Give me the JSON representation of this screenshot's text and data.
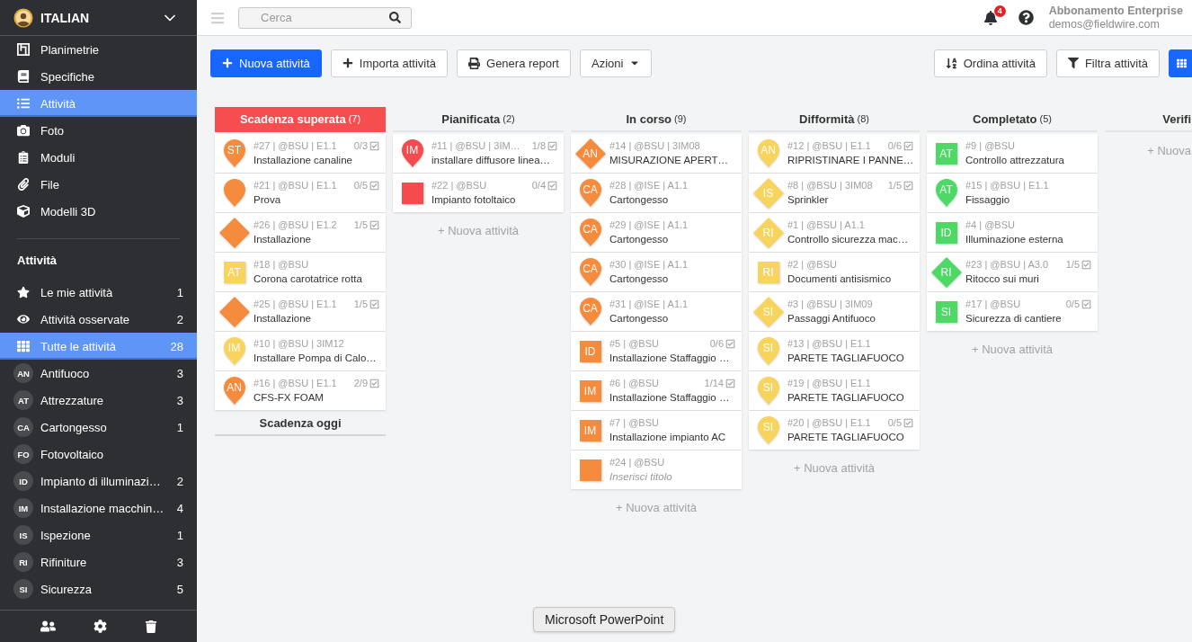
{
  "sidebar": {
    "project": {
      "name": "ITALIAN"
    },
    "nav": [
      {
        "label": "Planimetrie",
        "selected": false
      },
      {
        "label": "Specifiche",
        "selected": false
      },
      {
        "label": "Attività",
        "selected": true
      },
      {
        "label": "Foto",
        "selected": false
      },
      {
        "label": "Moduli",
        "selected": false
      },
      {
        "label": "File",
        "selected": false
      },
      {
        "label": "Modelli 3D",
        "selected": false
      }
    ],
    "section_title": "Attività",
    "filters": [
      {
        "kind": "icon",
        "label": "Le mie attività",
        "count": "1",
        "selected": false
      },
      {
        "kind": "icon",
        "label": "Attività osservate",
        "count": "2",
        "selected": false
      },
      {
        "kind": "icon",
        "label": "Tutte le attività",
        "count": "28",
        "selected": true
      },
      {
        "kind": "avatar",
        "initials": "AN",
        "label": "Antifuoco",
        "count": "3",
        "selected": false
      },
      {
        "kind": "avatar",
        "initials": "AT",
        "label": "Attrezzature",
        "count": "3",
        "selected": false
      },
      {
        "kind": "avatar",
        "initials": "CA",
        "label": "Cartongesso",
        "count": "1",
        "selected": false
      },
      {
        "kind": "avatar",
        "initials": "FO",
        "label": "Fotovoltaico",
        "selected": false
      },
      {
        "kind": "avatar",
        "initials": "ID",
        "label": "Impianto di illuminazi…",
        "count": "2",
        "selected": false
      },
      {
        "kind": "avatar",
        "initials": "IM",
        "label": "Installazione macchin…",
        "count": "4",
        "selected": false
      },
      {
        "kind": "avatar",
        "initials": "IS",
        "label": "Ispezione",
        "count": "1",
        "selected": false
      },
      {
        "kind": "avatar",
        "initials": "RI",
        "label": "Rifiniture",
        "count": "3",
        "selected": false
      },
      {
        "kind": "avatar",
        "initials": "SI",
        "label": "Sicurezza",
        "count": "5",
        "selected": false
      }
    ]
  },
  "topbar": {
    "search": {
      "placeholder": "Cerca"
    },
    "notifications": {
      "count": "4"
    },
    "account": {
      "plan": "Abbonamento Enterprise",
      "email": "demos@fieldwire.com"
    }
  },
  "toolbar": {
    "actions": [
      {
        "kind": "primary",
        "label": "Nuova attività"
      },
      {
        "kind": "add",
        "label": "Importa attività"
      },
      {
        "kind": "print",
        "label": "Genera report"
      },
      {
        "kind": "menu",
        "label": "Azioni"
      }
    ],
    "tools": [
      {
        "kind": "sort",
        "label": "Ordina attività"
      },
      {
        "kind": "filter",
        "label": "Filtra attività"
      }
    ],
    "view_toggle": {
      "selected": true
    }
  },
  "board": {
    "columns": [
      {
        "title": "Scadenza superata",
        "count": "(7)",
        "highlighted": true,
        "cards": [
          {
            "kind": "pin",
            "color": "#f58b3c",
            "initials": "ST",
            "meta": "#27 | @BSU | E1.1",
            "checklist": "0/3",
            "title": "Installazione canaline"
          },
          {
            "kind": "pin",
            "color": "#f58b3c",
            "meta": "#21 | @BSU | E1.1",
            "checklist": "0/5",
            "title": "Prova"
          },
          {
            "kind": "diamond",
            "color": "#f58b3c",
            "meta": "#26 | @BSU | E1.2",
            "checklist": "1/5",
            "title": "Installazione"
          },
          {
            "kind": "square",
            "color": "#f8d45c",
            "initials": "AT",
            "meta": "#18 | @BSU",
            "title": "Corona carotatrice rotta"
          },
          {
            "kind": "diamond",
            "color": "#f58b3c",
            "meta": "#25 | @BSU | E1.1",
            "checklist": "1/5",
            "title": "Installazione"
          },
          {
            "kind": "pin",
            "color": "#f8d45c",
            "initials": "IM",
            "meta": "#10 | @BSU | 3IM12",
            "title": "Installare Pompa di Calo…"
          },
          {
            "kind": "pin",
            "color": "#f58b3c",
            "initials": "AN",
            "meta": "#16 | @BSU | E1.1",
            "checklist": "2/9",
            "title": "CFS-FX FOAM"
          }
        ],
        "groups": [
          {
            "title": "Scadenza oggi"
          }
        ]
      },
      {
        "title": "Pianificata",
        "count": "(2)",
        "highlighted": false,
        "cards": [
          {
            "kind": "pin",
            "color": "#f54b4e",
            "initials": "IM",
            "meta": "#11 | @BSU | 3IM…",
            "checklist": "1/8",
            "title": "installare diffusore linea…"
          },
          {
            "kind": "square",
            "color": "#f54b4e",
            "meta": "#22 | @BSU",
            "checklist": "0/4",
            "title": "Impianto fotoltaico"
          }
        ],
        "add_label": "+ Nuova attività"
      },
      {
        "title": "In corso",
        "count": "(9)",
        "highlighted": false,
        "cards": [
          {
            "kind": "diamond",
            "color": "#f58b3c",
            "initials": "AN",
            "meta": "#14 | @BSU | 3IM08",
            "title": "MISURAZIONE APERT…"
          },
          {
            "kind": "pin",
            "color": "#f58b3c",
            "initials": "CA",
            "meta": "#28 | @ISE | A1.1",
            "title": "Cartongesso"
          },
          {
            "kind": "pin",
            "color": "#f58b3c",
            "initials": "CA",
            "meta": "#29 | @ISE | A1.1",
            "title": "Cartongesso"
          },
          {
            "kind": "pin",
            "color": "#f58b3c",
            "initials": "CA",
            "meta": "#30 | @ISE | A1.1",
            "title": "Cartongesso"
          },
          {
            "kind": "pin",
            "color": "#f58b3c",
            "initials": "CA",
            "meta": "#31 | @ISE | A1.1",
            "title": "Cartongesso"
          },
          {
            "kind": "square",
            "color": "#f58b3c",
            "initials": "ID",
            "meta": "#5 | @BSU",
            "checklist": "0/6",
            "title": "Installazione Staffaggio …"
          },
          {
            "kind": "square",
            "color": "#f58b3c",
            "initials": "IM",
            "meta": "#6 | @BSU",
            "checklist": "1/14",
            "title": "Installazione Staffaggio …"
          },
          {
            "kind": "square",
            "color": "#f58b3c",
            "initials": "IM",
            "meta": "#7 | @BSU",
            "title": "Installazione impianto AC"
          },
          {
            "kind": "square",
            "color": "#f58b3c",
            "meta": "#24 | @BSU",
            "placeholder": "Inserisci titolo"
          }
        ],
        "add_label": "+ Nuova attività"
      },
      {
        "title": "Difformità",
        "count": "(8)",
        "highlighted": false,
        "cards": [
          {
            "kind": "pin",
            "color": "#f8d45c",
            "initials": "AN",
            "meta": "#12 | @BSU | E1.1",
            "checklist": "0/6",
            "title": "RIPRISTINARE I PANNE…"
          },
          {
            "kind": "diamond",
            "color": "#f8d45c",
            "initials": "IS",
            "meta": "#8 | @BSU | 3IM08",
            "checklist": "1/5",
            "title": "Sprinkler"
          },
          {
            "kind": "diamond",
            "color": "#f8d45c",
            "initials": "RI",
            "meta": "#1 | @BSU | A1.1",
            "title": "Controllo sicurezza mac…"
          },
          {
            "kind": "square",
            "color": "#f8d45c",
            "initials": "RI",
            "meta": "#2 | @BSU",
            "title": "Documenti antisismico"
          },
          {
            "kind": "diamond",
            "color": "#f8d45c",
            "initials": "SI",
            "meta": "#3 | @BSU | 3IM09",
            "title": "Passaggi Antifuoco"
          },
          {
            "kind": "pin",
            "color": "#f8d45c",
            "initials": "SI",
            "meta": "#13 | @BSU | E1.1",
            "title": "PARETE TAGLIAFUOCO"
          },
          {
            "kind": "pin",
            "color": "#f8d45c",
            "initials": "SI",
            "meta": "#19 | @BSU | E1.1",
            "title": "PARETE TAGLIAFUOCO"
          },
          {
            "kind": "pin",
            "color": "#f8d45c",
            "initials": "SI",
            "meta": "#20 | @BSU | E1.1",
            "checklist": "0/5",
            "title": "PARETE TAGLIAFUOCO"
          }
        ],
        "add_label": "+ Nuova attività"
      },
      {
        "title": "Completato",
        "count": "(5)",
        "highlighted": false,
        "cards": [
          {
            "kind": "square",
            "color": "#4cd964",
            "initials": "AT",
            "meta": "#9 | @BSU",
            "title": "Controllo attrezzatura"
          },
          {
            "kind": "pin",
            "color": "#4cd964",
            "initials": "AT",
            "meta": "#15 | @BSU | E1.1",
            "title": "Fissaggio"
          },
          {
            "kind": "square",
            "color": "#4cd964",
            "initials": "ID",
            "meta": "#4 | @BSU",
            "title": "Illuminazione esterna"
          },
          {
            "kind": "diamond",
            "color": "#4cd964",
            "initials": "RI",
            "meta": "#23 | @BSU | A3.0",
            "checklist": "1/5",
            "title": "Ritocco sui muri"
          },
          {
            "kind": "square",
            "color": "#4cd964",
            "initials": "SI",
            "meta": "#17 | @BSU",
            "checklist": "0/5",
            "title": "Sicurezza di cantiere"
          }
        ],
        "add_label": "+ Nuova attività"
      },
      {
        "title": "Verifi",
        "highlighted": false,
        "add_label": "+ Nuova"
      }
    ]
  },
  "tooltip": {
    "text": "Microsoft PowerPoint"
  }
}
